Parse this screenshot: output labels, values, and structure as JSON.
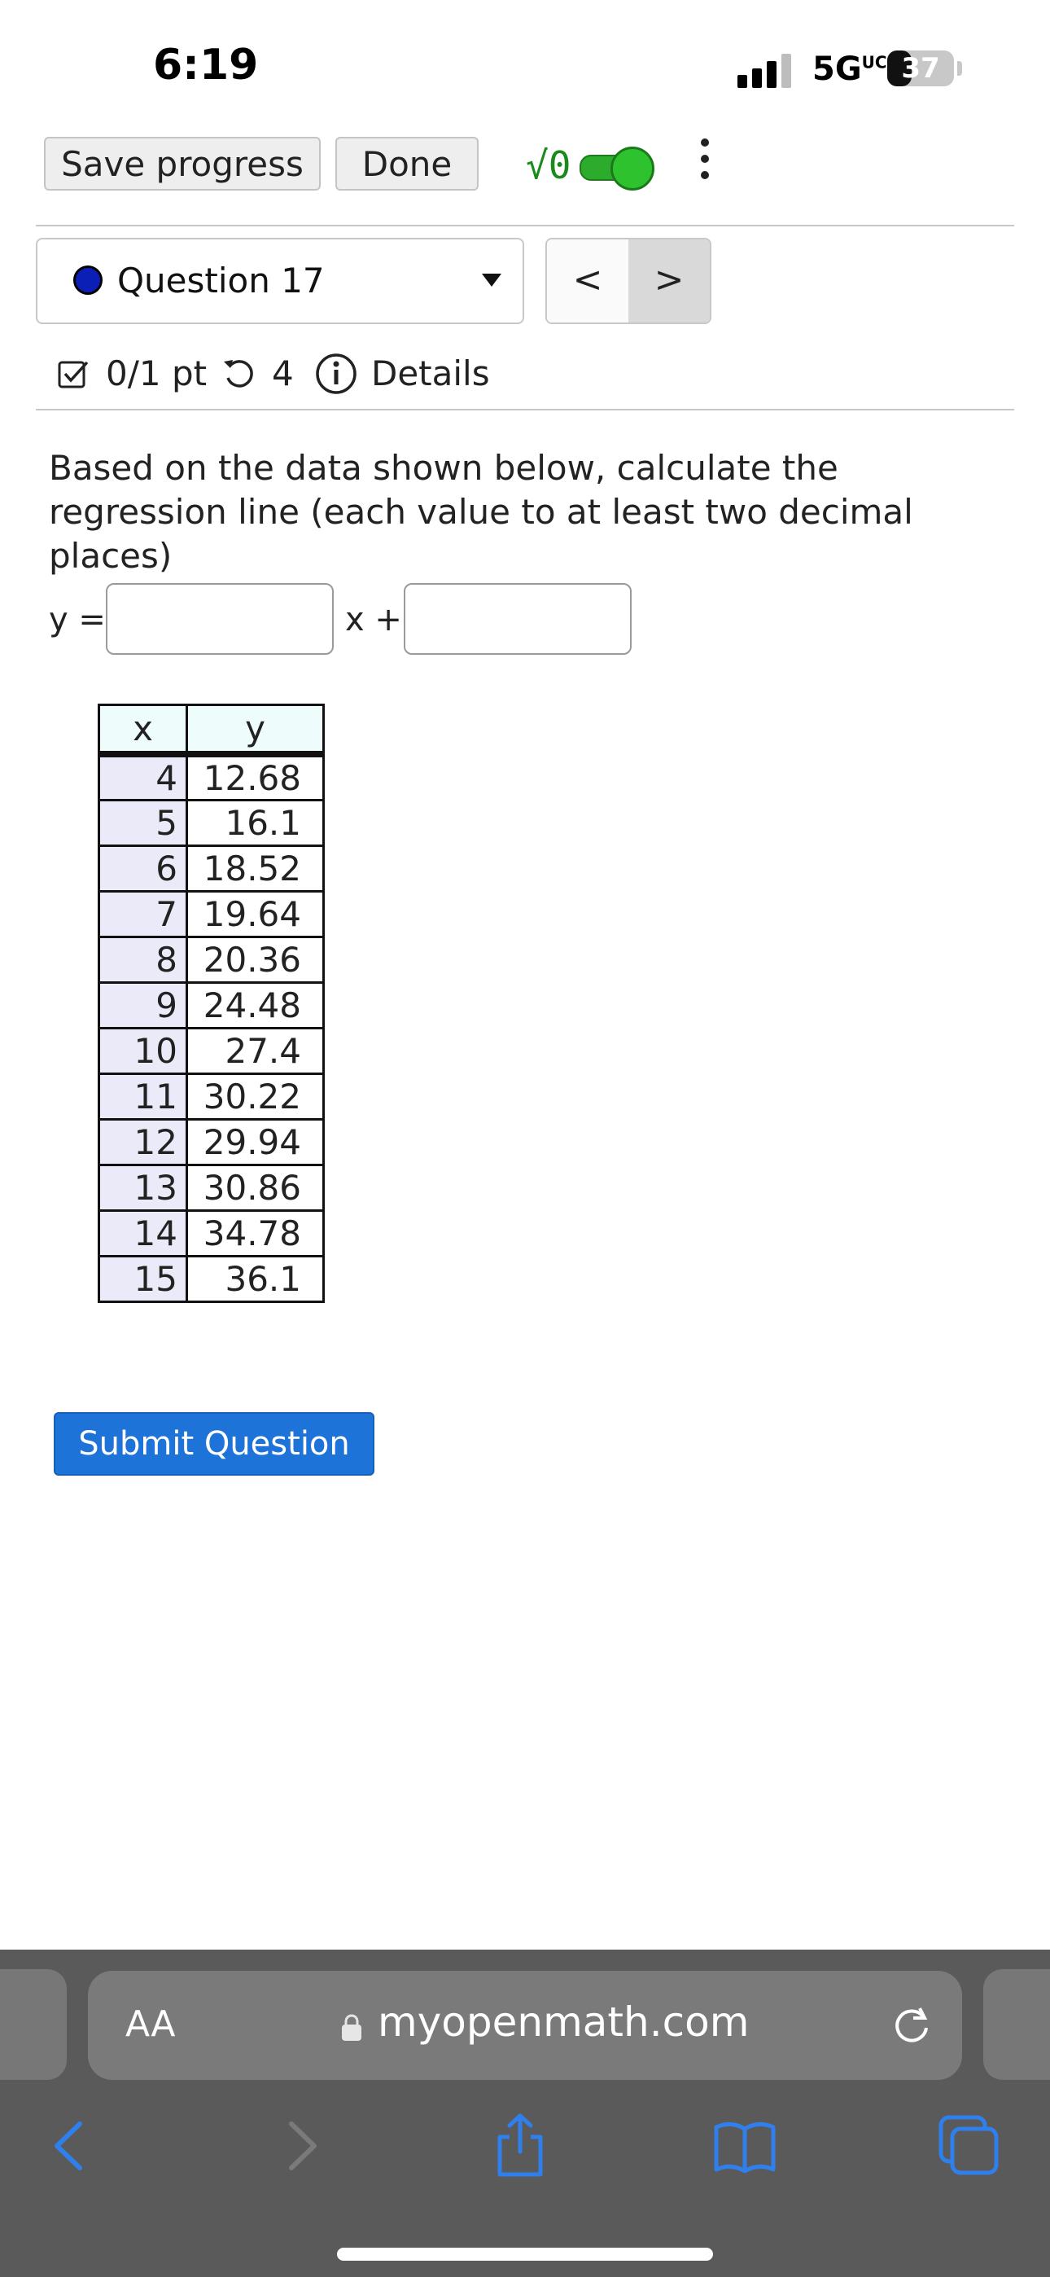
{
  "status_bar": {
    "time": "6:19",
    "network": "5G",
    "network_suffix": "UC",
    "battery": "37",
    "battery_level": 0.37
  },
  "toolbar": {
    "save_label": "Save progress",
    "done_label": "Done",
    "math_toggle_label": "√0",
    "math_toggle_on": true
  },
  "question_nav": {
    "selected": "Question 17",
    "prev": "<",
    "next": ">"
  },
  "meta": {
    "score": "0/1 pt",
    "retries": "4",
    "details": "Details"
  },
  "question": {
    "prompt": "Based on the data shown below, calculate the regression line (each value to at least two decimal places)",
    "y_label": "y =",
    "x_label": "x +",
    "slope_value": "",
    "intercept_value": ""
  },
  "table": {
    "headers": [
      "x",
      "y"
    ],
    "rows": [
      [
        "4",
        "12.68"
      ],
      [
        "5",
        "16.1"
      ],
      [
        "6",
        "18.52"
      ],
      [
        "7",
        "19.64"
      ],
      [
        "8",
        "20.36"
      ],
      [
        "9",
        "24.48"
      ],
      [
        "10",
        "27.4"
      ],
      [
        "11",
        "30.22"
      ],
      [
        "12",
        "29.94"
      ],
      [
        "13",
        "30.86"
      ],
      [
        "14",
        "34.78"
      ],
      [
        "15",
        "36.1"
      ]
    ]
  },
  "submit_label": "Submit Question",
  "browser": {
    "text_size": "AA",
    "url": "myopenmath.com"
  },
  "colors": {
    "accent_blue": "#1e73d8",
    "toggle_green": "#2fc22f",
    "question_dot": "#0b1eb5",
    "safari_bar": "#5a5a5a",
    "ios_blue": "#2f80ed"
  }
}
